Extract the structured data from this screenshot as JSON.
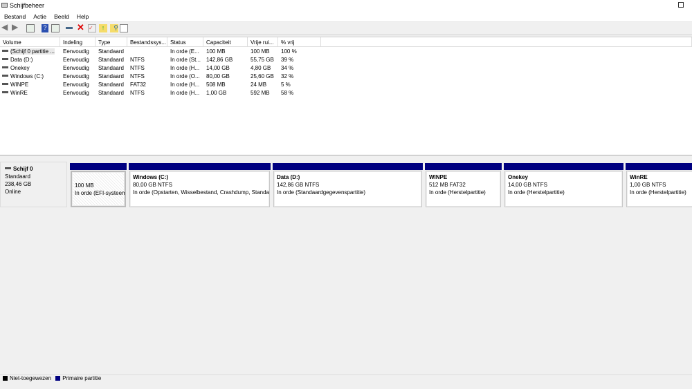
{
  "window": {
    "title": "Schijfbeheer"
  },
  "menu": [
    "Bestand",
    "Actie",
    "Beeld",
    "Help"
  ],
  "columns": [
    "Volume",
    "Indeling",
    "Type",
    "Bestandssys...",
    "Status",
    "Capaciteit",
    "Vrije rui...",
    "% vrij"
  ],
  "volumes": [
    [
      "(Schijf 0 partitie ...",
      "Eenvoudig",
      "Standaard",
      "",
      "In orde (E...",
      "100 MB",
      "100 MB",
      "100 %"
    ],
    [
      "Data (D:)",
      "Eenvoudig",
      "Standaard",
      "NTFS",
      "In orde (St...",
      "142,86 GB",
      "55,75 GB",
      "39 %"
    ],
    [
      "Onekey",
      "Eenvoudig",
      "Standaard",
      "NTFS",
      "In orde (H...",
      "14,00 GB",
      "4,80 GB",
      "34 %"
    ],
    [
      "Windows (C:)",
      "Eenvoudig",
      "Standaard",
      "NTFS",
      "In orde (O...",
      "80,00 GB",
      "25,60 GB",
      "32 %"
    ],
    [
      "WINPE",
      "Eenvoudig",
      "Standaard",
      "FAT32",
      "In orde (H...",
      "508 MB",
      "24 MB",
      "5 %"
    ],
    [
      "WinRE",
      "Eenvoudig",
      "Standaard",
      "NTFS",
      "In orde (H...",
      "1,00 GB",
      "592 MB",
      "58 %"
    ]
  ],
  "disk": {
    "name": "Schijf 0",
    "type": "Standaard",
    "size": "238,46 GB",
    "state": "Online"
  },
  "partitions": [
    {
      "name": "",
      "size": "100 MB",
      "status": "In orde (EFI-systeempartitie)"
    },
    {
      "name": "Windows  (C:)",
      "size": "80,00 GB NTFS",
      "status": "In orde (Opstarten, Wisselbestand, Crashdump, Standaardgegevenspartitie)"
    },
    {
      "name": "Data  (D:)",
      "size": "142,86 GB NTFS",
      "status": "In orde (Standaardgegevenspartitie)"
    },
    {
      "name": "WINPE",
      "size": "512 MB FAT32",
      "status": "In orde (Herstelpartitie)"
    },
    {
      "name": "Onekey",
      "size": "14,00 GB NTFS",
      "status": "In orde (Herstelpartitie)"
    },
    {
      "name": "WinRE",
      "size": "1,00 GB NTFS",
      "status": "In orde (Herstelpartitie)"
    }
  ],
  "legend": [
    {
      "label": "Niet-toegewezen",
      "color": "#000000"
    },
    {
      "label": "Primaire partitie",
      "color": "#000080"
    }
  ]
}
